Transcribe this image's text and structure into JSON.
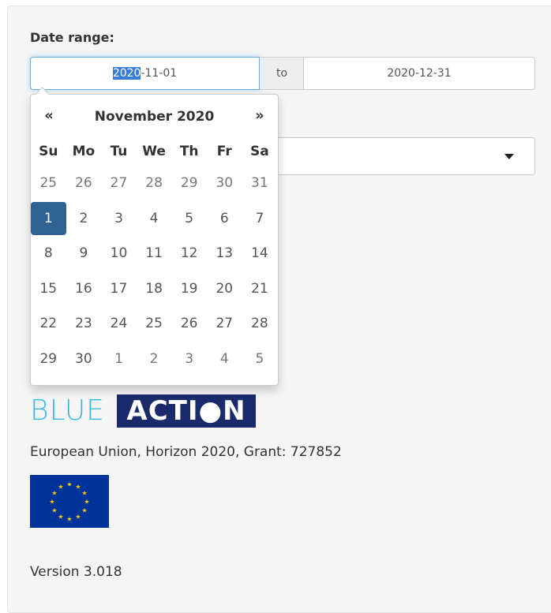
{
  "form": {
    "label": "Date range:",
    "start_date": {
      "selected": "2020",
      "rest": "-11-01"
    },
    "separator": "to",
    "end_date": "2020-12-31"
  },
  "calendar": {
    "prev": "«",
    "next": "»",
    "title": "November 2020",
    "weekdays": [
      "Su",
      "Mo",
      "Tu",
      "We",
      "Th",
      "Fr",
      "Sa"
    ],
    "weeks": [
      [
        "25",
        "26",
        "27",
        "28",
        "29",
        "30",
        "31"
      ],
      [
        "1",
        "2",
        "3",
        "4",
        "5",
        "6",
        "7"
      ],
      [
        "8",
        "9",
        "10",
        "11",
        "12",
        "13",
        "14"
      ],
      [
        "15",
        "16",
        "17",
        "18",
        "19",
        "20",
        "21"
      ],
      [
        "22",
        "23",
        "24",
        "25",
        "26",
        "27",
        "28"
      ],
      [
        "29",
        "30",
        "1",
        "2",
        "3",
        "4",
        "5"
      ]
    ],
    "selected": "1"
  },
  "logo": {
    "blue": "BLUE",
    "action": "ACTI●N"
  },
  "funding": {
    "text": "European Union, Horizon 2020, Grant: 727852"
  },
  "footer": {
    "version": "Version 3.018"
  },
  "colors": {
    "accent": "#2f6293",
    "eu_blue": "#003399",
    "eu_star": "#ffcc00"
  },
  "icons": {
    "select_caret": "chevron-down-icon",
    "eu_flag": "eu-flag-icon"
  }
}
